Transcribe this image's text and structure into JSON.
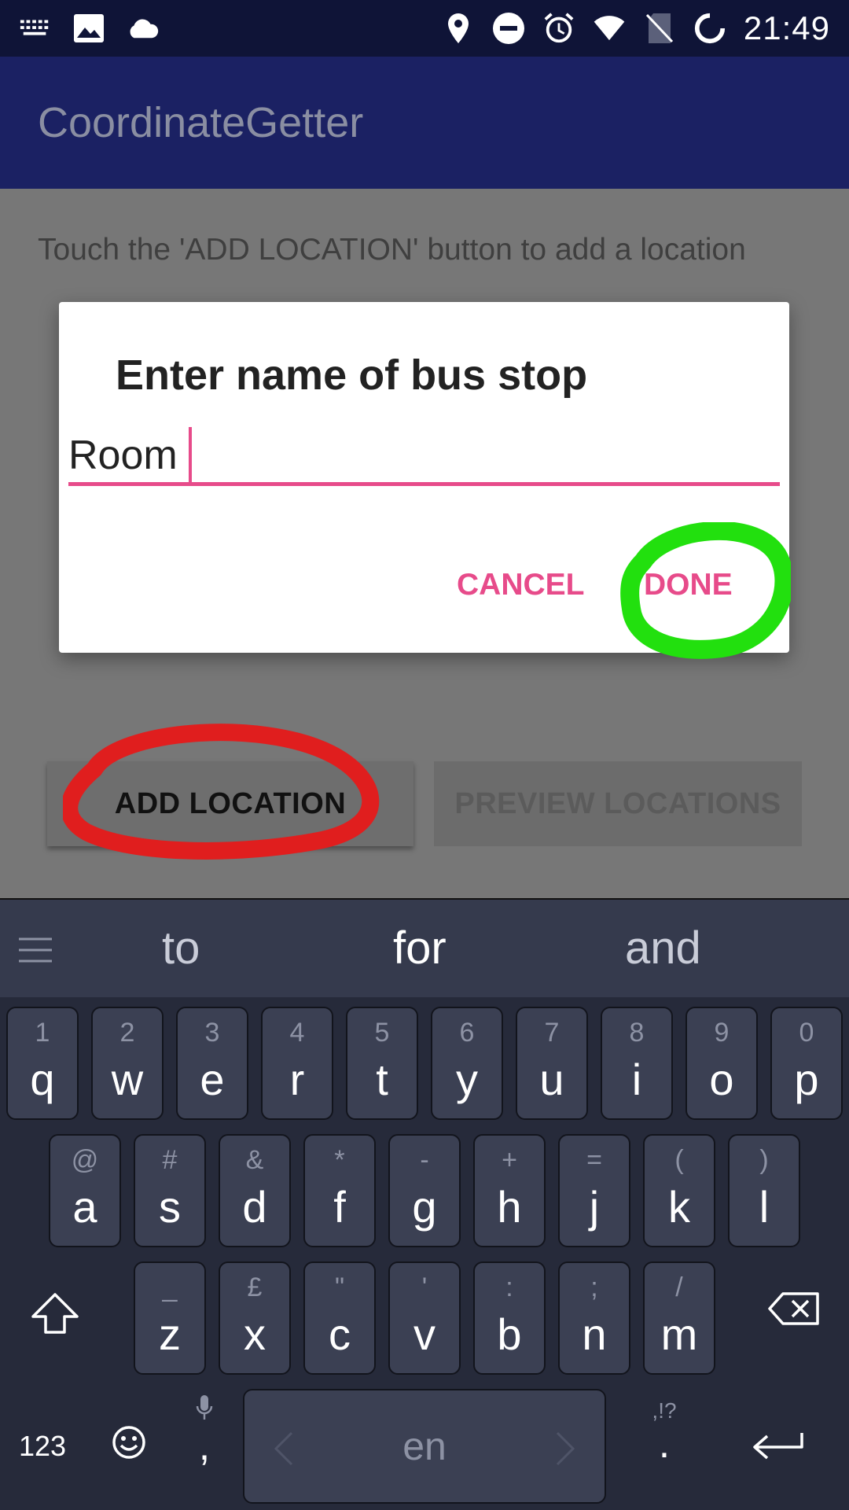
{
  "status_bar": {
    "time": "21:49",
    "left_icons": [
      "keyboard-icon",
      "image-icon",
      "cloud-icon"
    ],
    "right_icons": [
      "location-icon",
      "do-not-disturb-icon",
      "alarm-icon",
      "wifi-icon",
      "no-sim-icon",
      "battery-icon"
    ]
  },
  "app_bar": {
    "title": "CoordinateGetter"
  },
  "main": {
    "hint": "Touch the 'ADD LOCATION' button to add a location",
    "add_button": "ADD LOCATION",
    "preview_button": "PREVIEW LOCATIONS"
  },
  "dialog": {
    "title": "Enter name of bus stop",
    "input_value": "Room",
    "cancel": "CANCEL",
    "done": "DONE"
  },
  "keyboard": {
    "suggestions": [
      "to",
      "for",
      "and"
    ],
    "row1": [
      {
        "main": "q",
        "sub": "1"
      },
      {
        "main": "w",
        "sub": "2"
      },
      {
        "main": "e",
        "sub": "3"
      },
      {
        "main": "r",
        "sub": "4"
      },
      {
        "main": "t",
        "sub": "5"
      },
      {
        "main": "y",
        "sub": "6"
      },
      {
        "main": "u",
        "sub": "7"
      },
      {
        "main": "i",
        "sub": "8"
      },
      {
        "main": "o",
        "sub": "9"
      },
      {
        "main": "p",
        "sub": "0"
      }
    ],
    "row2": [
      {
        "main": "a",
        "sub": "@"
      },
      {
        "main": "s",
        "sub": "#"
      },
      {
        "main": "d",
        "sub": "&"
      },
      {
        "main": "f",
        "sub": "*"
      },
      {
        "main": "g",
        "sub": "-"
      },
      {
        "main": "h",
        "sub": "+"
      },
      {
        "main": "j",
        "sub": "="
      },
      {
        "main": "k",
        "sub": "("
      },
      {
        "main": "l",
        "sub": ")"
      }
    ],
    "row3": [
      {
        "main": "z",
        "sub": "_"
      },
      {
        "main": "x",
        "sub": "£"
      },
      {
        "main": "c",
        "sub": "\""
      },
      {
        "main": "v",
        "sub": "'"
      },
      {
        "main": "b",
        "sub": ":"
      },
      {
        "main": "n",
        "sub": ";"
      },
      {
        "main": "m",
        "sub": "/"
      }
    ],
    "numbers_key": "123",
    "comma": ",",
    "space_label": "en",
    "period_sub": ",!?",
    "period": "."
  },
  "colors": {
    "accent": "#e74b8a",
    "app_bar": "#1b2163",
    "status_bar": "#0f1437",
    "annotation_red": "#e01e1e",
    "annotation_green": "#22e00e"
  }
}
